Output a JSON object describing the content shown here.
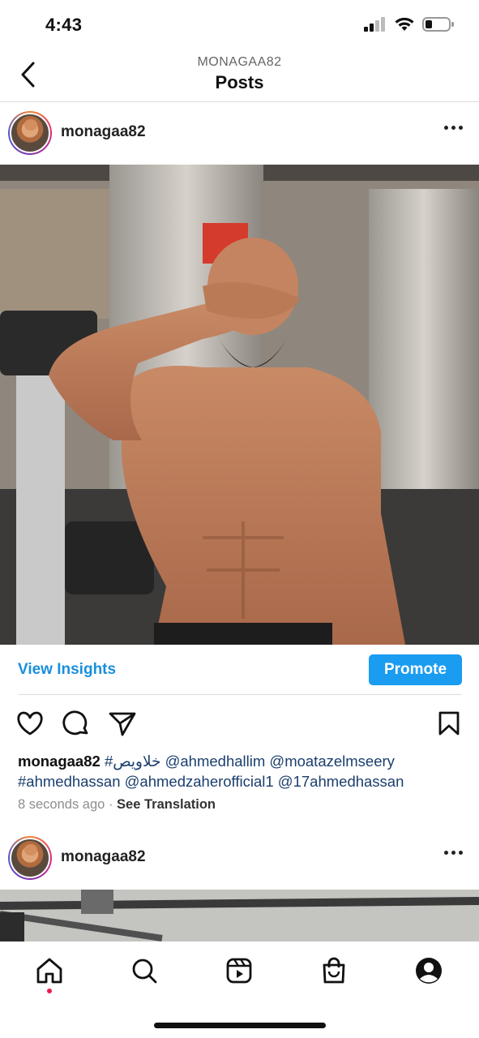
{
  "status": {
    "time": "4:43",
    "icons": [
      "signal-icon",
      "wifi-icon",
      "battery-icon"
    ]
  },
  "nav": {
    "subtitle": "MONAGAA82",
    "title": "Posts",
    "back_icon": "chevron-left-icon"
  },
  "post1": {
    "username": "monagaa82",
    "insights_label": "View Insights",
    "promote_label": "Promote",
    "caption_user": "monagaa82",
    "caption_hashtag": "#خلاويص",
    "caption_line1_tags": "@ahmedhallim @moatazelmseery",
    "caption_line2": "#ahmedhassan @ahmedzaherofficial1 @17ahmedhassan",
    "time_ago": "8 seconds ago",
    "separator": "·",
    "see_translation": "See Translation"
  },
  "post2": {
    "username": "monagaa82"
  },
  "tabs": [
    "home-icon",
    "search-icon",
    "reels-icon",
    "shop-icon",
    "profile-icon"
  ],
  "colors": {
    "accent": "#1a9cf0",
    "link": "#1a8fdc",
    "active_dot": "#ed1c4b"
  }
}
